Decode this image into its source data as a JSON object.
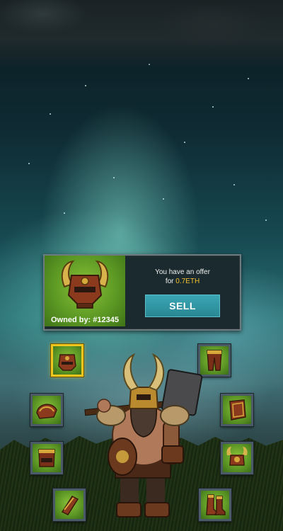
{
  "offer": {
    "owned_label": "Owned by: #12345",
    "offer_line1": "You have an offer",
    "offer_prefix": "for ",
    "offer_amount": "0.7ETH",
    "sell_label": "SELL"
  },
  "equipment_slots": [
    {
      "name": "chest-armor",
      "icon": "chest-armor-icon",
      "selected": true
    },
    {
      "name": "leg-armor",
      "icon": "leg-armor-icon",
      "selected": false
    },
    {
      "name": "pauldron",
      "icon": "pauldron-icon",
      "selected": false
    },
    {
      "name": "shield",
      "icon": "shield-icon",
      "selected": false
    },
    {
      "name": "body-armor",
      "icon": "body-armor-icon",
      "selected": false
    },
    {
      "name": "horned-helmet",
      "icon": "horned-helmet-icon",
      "selected": false
    },
    {
      "name": "bracer",
      "icon": "bracer-icon",
      "selected": false
    },
    {
      "name": "boots",
      "icon": "boots-icon",
      "selected": false
    }
  ],
  "colors": {
    "slot_green": "#6ba82a",
    "selected_border": "#f0c51e",
    "sell_button": "#2f95a3",
    "eth_text": "#f2c230"
  }
}
